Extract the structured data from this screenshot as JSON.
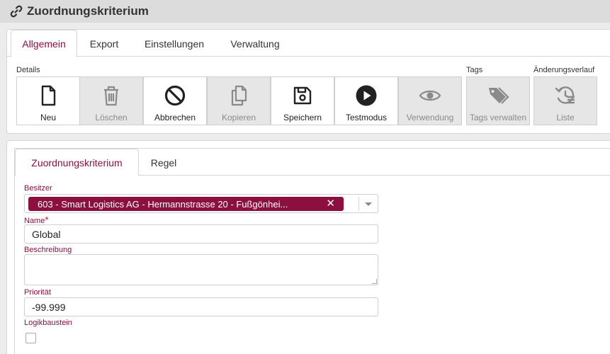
{
  "window": {
    "title": "Zuordnungskriterium"
  },
  "top_tabs": [
    {
      "label": "Allgemein",
      "active": true
    },
    {
      "label": "Export",
      "active": false
    },
    {
      "label": "Einstellungen",
      "active": false
    },
    {
      "label": "Verwaltung",
      "active": false
    }
  ],
  "toolbar": {
    "groups": {
      "details": "Details",
      "tags": "Tags",
      "history": "Änderungsverlauf"
    },
    "buttons": {
      "neu": {
        "label": "Neu",
        "icon": "new-document-icon",
        "enabled": true
      },
      "loeschen": {
        "label": "Löschen",
        "icon": "trash-icon",
        "enabled": false
      },
      "abbrechen": {
        "label": "Abbrechen",
        "icon": "cancel-icon",
        "enabled": true
      },
      "kopieren": {
        "label": "Kopieren",
        "icon": "copy-icon",
        "enabled": false
      },
      "speichern": {
        "label": "Speichern",
        "icon": "save-icon",
        "enabled": true
      },
      "testmodus": {
        "label": "Testmodus",
        "icon": "play-icon",
        "enabled": true
      },
      "verwendung": {
        "label": "Verwendung",
        "icon": "eye-icon",
        "enabled": false
      },
      "tags": {
        "label": "Tags verwalten",
        "icon": "tags-icon",
        "enabled": false
      },
      "liste": {
        "label": "Liste",
        "icon": "history-list-icon",
        "enabled": false
      }
    }
  },
  "form_tabs": [
    {
      "label": "Zuordnungskriterium",
      "active": true
    },
    {
      "label": "Regel",
      "active": false
    }
  ],
  "form": {
    "besitzer": {
      "label": "Besitzer",
      "value": "603 - Smart Logistics AG - Hermannstrasse 20 - Fußgönhei..."
    },
    "name": {
      "label": "Name",
      "required_mark": "*",
      "value": "Global"
    },
    "beschreibung": {
      "label": "Beschreibung",
      "value": ""
    },
    "prioritaet": {
      "label": "Priorität",
      "value": "-99.999"
    },
    "logikbaustein": {
      "label": "Logikbaustein",
      "checked": false
    }
  },
  "colors": {
    "accent": "#8b1040",
    "titlebar": "#dcdcdc",
    "disabled": "#e6e6e6"
  }
}
